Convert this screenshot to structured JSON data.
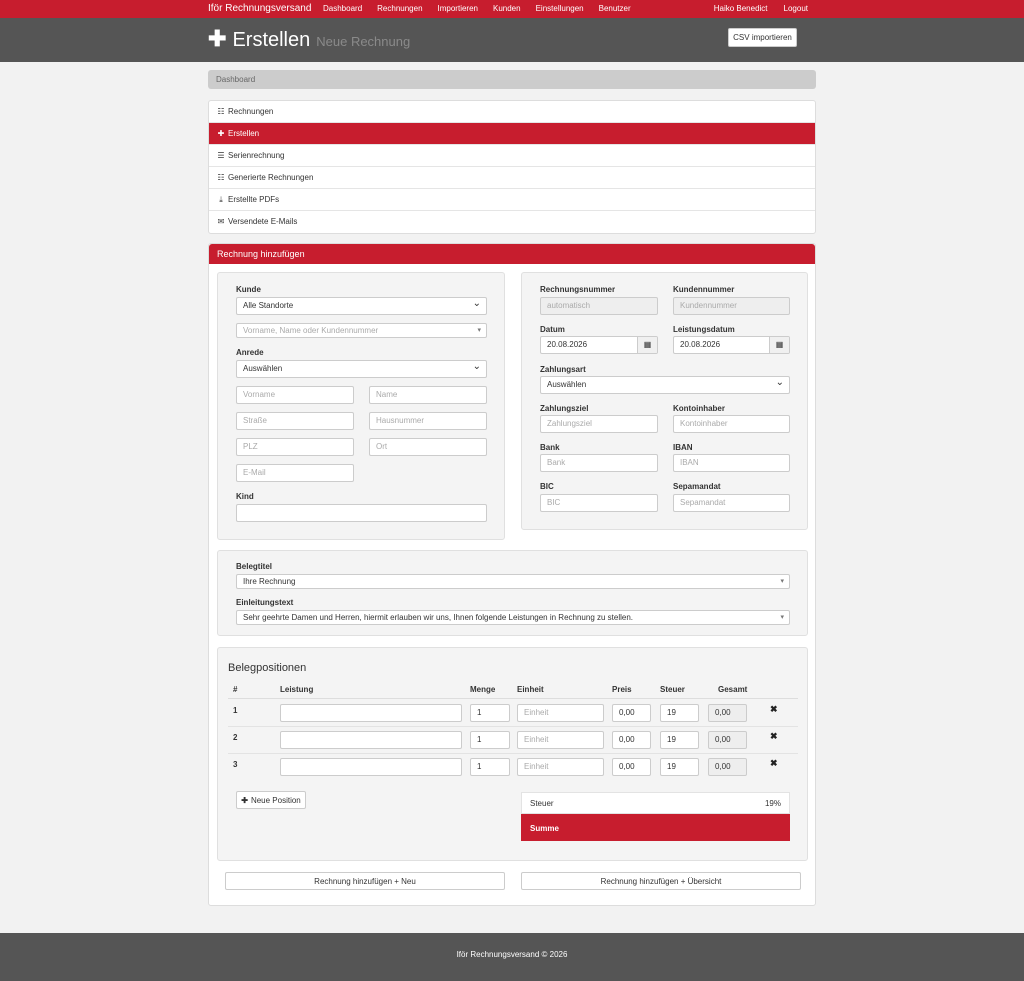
{
  "nav": {
    "brand": "Iför Rechnungsversand",
    "links": [
      "Dashboard",
      "Rechnungen",
      "Importieren",
      "Kunden",
      "Einstellungen",
      "Benutzer"
    ],
    "user": "Haiko Benedict",
    "logout": "Logout"
  },
  "header": {
    "title": "Erstellen",
    "subtitle": "Neue Rechnung",
    "csv_button": "CSV importieren"
  },
  "breadcrumb": "Dashboard",
  "sidebar": {
    "items": [
      {
        "label": "Rechnungen",
        "icon": "list-icon"
      },
      {
        "label": "Erstellen",
        "icon": "plus-icon",
        "active": true
      },
      {
        "label": "Serienrechnung",
        "icon": "list-icon"
      },
      {
        "label": "Generierte Rechnungen",
        "icon": "list-icon"
      },
      {
        "label": "Erstellte PDFs",
        "icon": "download-icon"
      },
      {
        "label": "Versendete E-Mails",
        "icon": "envelope-icon"
      }
    ]
  },
  "panel_title": "Rechnung hinzufügen",
  "customer": {
    "kunde_label": "Kunde",
    "standort_select": "Alle Standorte",
    "search_placeholder": "Vorname, Name oder Kundennummer",
    "anrede_label": "Anrede",
    "anrede_select": "Auswählen",
    "vorname_ph": "Vorname",
    "name_ph": "Name",
    "strasse_ph": "Straße",
    "hausnummer_ph": "Hausnummer",
    "plz_ph": "PLZ",
    "ort_ph": "Ort",
    "email_ph": "E-Mail",
    "kind_label": "Kind"
  },
  "invoice": {
    "rechnungsnummer_label": "Rechnungsnummer",
    "rechnungsnummer_val": "automatisch",
    "kundennummer_label": "Kundennummer",
    "kundennummer_val": "Kundennummer",
    "datum_label": "Datum",
    "datum_val": "20.08.2026",
    "leistungsdatum_label": "Leistungsdatum",
    "leistungsdatum_val": "20.08.2026",
    "zahlungsart_label": "Zahlungsart",
    "zahlungsart_select": "Auswählen",
    "zahlungsziel_label": "Zahlungsziel",
    "zahlungsziel_ph": "Zahlungsziel",
    "kontoinhaber_label": "Kontoinhaber",
    "kontoinhaber_ph": "Kontoinhaber",
    "bank_label": "Bank",
    "bank_ph": "Bank",
    "iban_label": "IBAN",
    "iban_ph": "IBAN",
    "bic_label": "BIC",
    "bic_ph": "BIC",
    "sepa_label": "Sepamandat",
    "sepa_ph": "Sepamandat"
  },
  "beleg": {
    "titel_label": "Belegtitel",
    "titel_val": "Ihre Rechnung",
    "einleitung_label": "Einleitungstext",
    "einleitung_val": "Sehr geehrte Damen und Herren, hiermit erlauben wir uns, Ihnen folgende Leistungen in Rechnung zu stellen."
  },
  "positions": {
    "heading": "Belegpositionen",
    "columns": [
      "#",
      "Leistung",
      "Menge",
      "Einheit",
      "Preis",
      "Steuer",
      "Gesamt"
    ],
    "rows": [
      {
        "num": "1",
        "menge": "1",
        "einheit_ph": "Einheit",
        "preis": "0,00",
        "steuer": "19",
        "gesamt": "0,00"
      },
      {
        "num": "2",
        "menge": "1",
        "einheit_ph": "Einheit",
        "preis": "0,00",
        "steuer": "19",
        "gesamt": "0,00"
      },
      {
        "num": "3",
        "menge": "1",
        "einheit_ph": "Einheit",
        "preis": "0,00",
        "steuer": "19",
        "gesamt": "0,00"
      }
    ],
    "new_position": "Neue Position",
    "steuer_label": "Steuer",
    "steuer_val": "19%",
    "summe_label": "Summe"
  },
  "actions": {
    "add_new": "Rechnung hinzufügen + Neu",
    "add_overview": "Rechnung hinzufügen + Übersicht"
  },
  "footer": "Iför Rechnungsversand © 2026",
  "colors": {
    "accent": "#c71d2e",
    "header": "#555555"
  }
}
